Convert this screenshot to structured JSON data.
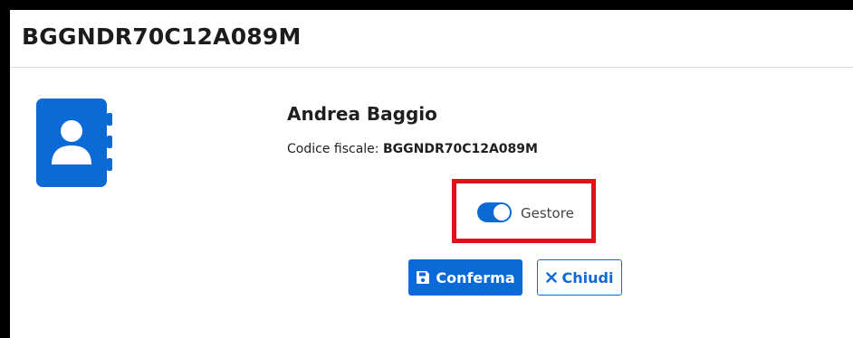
{
  "header": {
    "title": "BGGNDR70C12A089M"
  },
  "profile": {
    "name": "Andrea Baggio",
    "cf_label": "Codice fiscale:",
    "cf_value": "BGGNDR70C12A089M"
  },
  "toggle": {
    "label": "Gestore",
    "checked": true
  },
  "actions": {
    "confirm_label": "Conferma",
    "close_label": "Chiudi"
  },
  "icons": {
    "avatar": "address-book-icon",
    "confirm": "save-icon",
    "close": "close-icon"
  },
  "colors": {
    "primary": "#0b6ad6",
    "highlight": "#e1101b"
  }
}
